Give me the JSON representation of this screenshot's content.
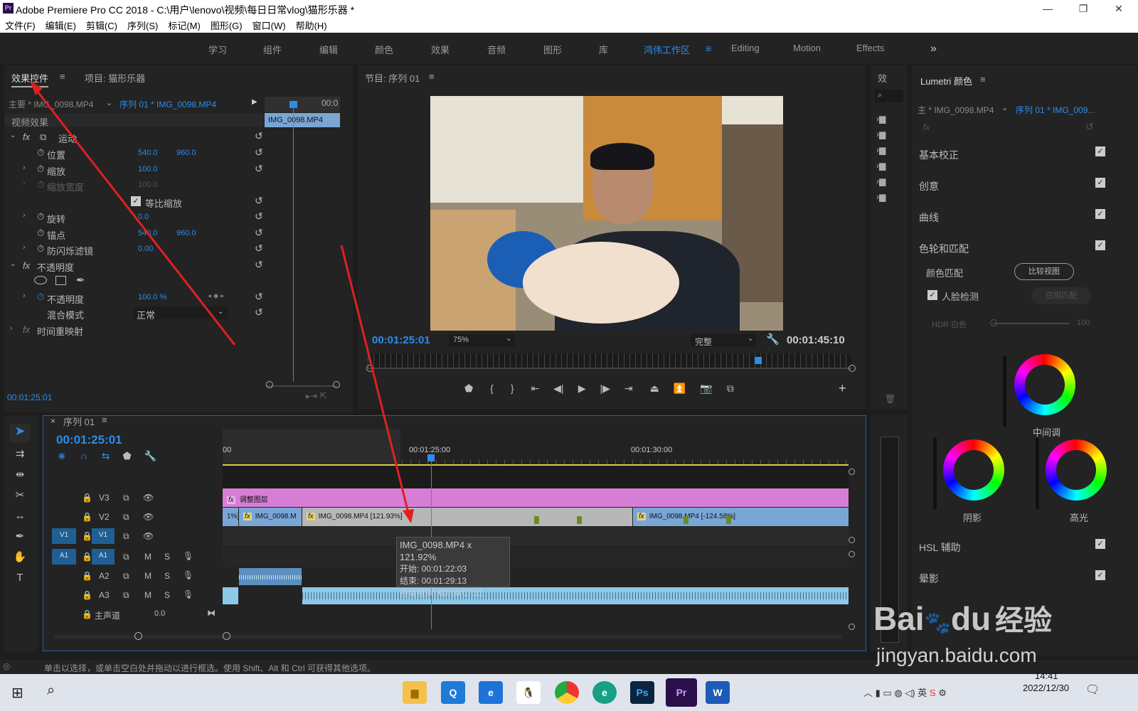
{
  "window": {
    "title": "Adobe Premiere Pro CC 2018 - C:\\用户\\lenovo\\视频\\每日日常vlog\\猫形乐器 *",
    "logo": "Pr"
  },
  "menu": [
    "文件(F)",
    "编辑(E)",
    "剪辑(C)",
    "序列(S)",
    "标记(M)",
    "图形(G)",
    "窗口(W)",
    "帮助(H)"
  ],
  "workspaces": [
    "学习",
    "组件",
    "编辑",
    "颜色",
    "效果",
    "音频",
    "图形",
    "库",
    "鸿伟工作区",
    "Editing",
    "Motion",
    "Effects"
  ],
  "effect_controls": {
    "tab_active": "效果控件",
    "tab_project": "项目: 猫形乐器",
    "master": "主要 * IMG_0098.MP4",
    "sequence": "序列 01 * IMG_0098.MP4",
    "mini_time": "00:0",
    "mini_clip": "IMG_0098.MP4",
    "video_effects": "视频效果",
    "motion": "运动",
    "position_label": "位置",
    "position_x": "540.0",
    "position_y": "960.0",
    "scale_label": "缩放",
    "scale": "100.0",
    "scale_width_label": "缩放宽度",
    "scale_width": "100.0",
    "uniform_scale": "等比缩放",
    "rotation_label": "旋转",
    "rotation": "0.0",
    "anchor_label": "锚点",
    "anchor_x": "540.0",
    "anchor_y": "960.0",
    "antiflicker_label": "防闪烁滤镜",
    "antiflicker": "0.00",
    "opacity_group": "不透明度",
    "opacity_label": "不透明度",
    "opacity": "100.0 %",
    "blend_label": "混合模式",
    "blend": "正常",
    "time_remap": "时间重映射",
    "timecode": "00:01:25:01"
  },
  "program": {
    "title": "节目: 序列 01",
    "timecode": "00:01:25:01",
    "zoom": "75%",
    "quality": "完整",
    "duration": "00:01:45:10"
  },
  "effects_panel": {
    "title": "效"
  },
  "timeline": {
    "title": "序列 01",
    "timecode": "00:01:25:01",
    "ruler": [
      "00",
      "00:01:25:00",
      "00:01:30:00"
    ],
    "tracks": [
      "V3",
      "V2",
      "V1",
      "A1",
      "A2",
      "A3"
    ],
    "master_label": "主声道",
    "master_value": "0.0",
    "clips": {
      "adjust": "调整图层",
      "v2a": "1%]",
      "v2b": "IMG_0098.M",
      "v2c": "IMG_0098.MP4 [121.93%]",
      "v2d": "IMG_0098.MP4 [-124.58%]"
    },
    "tooltip": {
      "name": "IMG_0098.MP4 x 121.92%",
      "start": "开始: 00:01:22:03",
      "end": "结束: 00:01:29:13",
      "duration": "持续时间: 00:00:07:11"
    }
  },
  "lumetri": {
    "title": "Lumetri 颜色",
    "master": "主 * IMG_0098.MP4",
    "sequence": "序列 01 * IMG_009...",
    "sections": [
      "基本校正",
      "创意",
      "曲线",
      "色轮和匹配"
    ],
    "color_match": "颜色匹配",
    "compare_view": "比较视图",
    "face_detect": "人脸检测",
    "apply_match": "应用匹配",
    "hdr": "HDR 白色",
    "hdr_value": "100",
    "midtones": "中间调",
    "shadows": "阴影",
    "highlights": "高光",
    "hsl": "HSL 辅助",
    "vignette": "晕影"
  },
  "status": "单击以选择，或单击空白处并拖动以进行框选。使用 Shift、Alt 和 Ctrl 可获得其他选项。",
  "watermark": {
    "brand": "Bai",
    "brand2": "du",
    "brand_cn": "经验",
    "url": "jingyan.baidu.com"
  },
  "taskbar": {
    "time": "14:41",
    "date": "2022/12/30",
    "ime": "英"
  },
  "colors": {
    "accent": "#2d8ceb",
    "adjust_layer": "#d67ed6",
    "clip_v2": "#b7b7b7",
    "clip_blue": "#7aa6d6",
    "audio": "#8ec8e8",
    "arrow": "#e02020"
  }
}
